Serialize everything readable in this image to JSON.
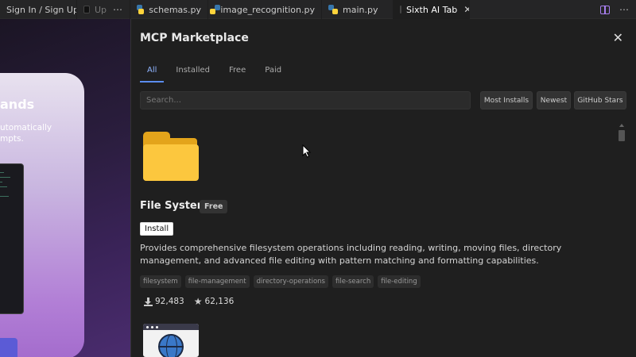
{
  "tabs": [
    {
      "label": "Sign In / Sign Up",
      "icon": "none",
      "has_close": true
    },
    {
      "label": "Up",
      "icon": "dark-app-icon",
      "has_more": true
    },
    {
      "label": "schemas.py",
      "icon": "python-icon"
    },
    {
      "label": "image_recognition.py",
      "icon": "python-icon"
    },
    {
      "label": "main.py",
      "icon": "python-icon"
    },
    {
      "label": "Sixth AI Tab",
      "icon": "dark-app-icon",
      "has_close": true,
      "active": true
    }
  ],
  "background_card": {
    "title": "ands",
    "text_line1": "utomatically",
    "text_line2": "mpts."
  },
  "modal": {
    "title": "MCP Marketplace",
    "close_glyph": "✕",
    "filter_tabs": [
      "All",
      "Installed",
      "Free",
      "Paid"
    ],
    "active_filter": "All",
    "search_placeholder": "Search...",
    "sort_buttons": [
      "Most Installs",
      "Newest",
      "GitHub Stars"
    ]
  },
  "item": {
    "name": "File System",
    "badge": "Free",
    "install_label": "Install",
    "description": "Provides comprehensive filesystem operations including reading, writing, moving files, directory management, and advanced file editing with pattern matching and formatting capabilities.",
    "tags": [
      "filesystem",
      "file-management",
      "directory-operations",
      "file-search",
      "file-editing"
    ],
    "downloads": "92,483",
    "stars": "62,136"
  },
  "colors": {
    "accent_tab": "#5b8def",
    "folder": "#fcc73e",
    "split_icon": "#a97ff0"
  }
}
